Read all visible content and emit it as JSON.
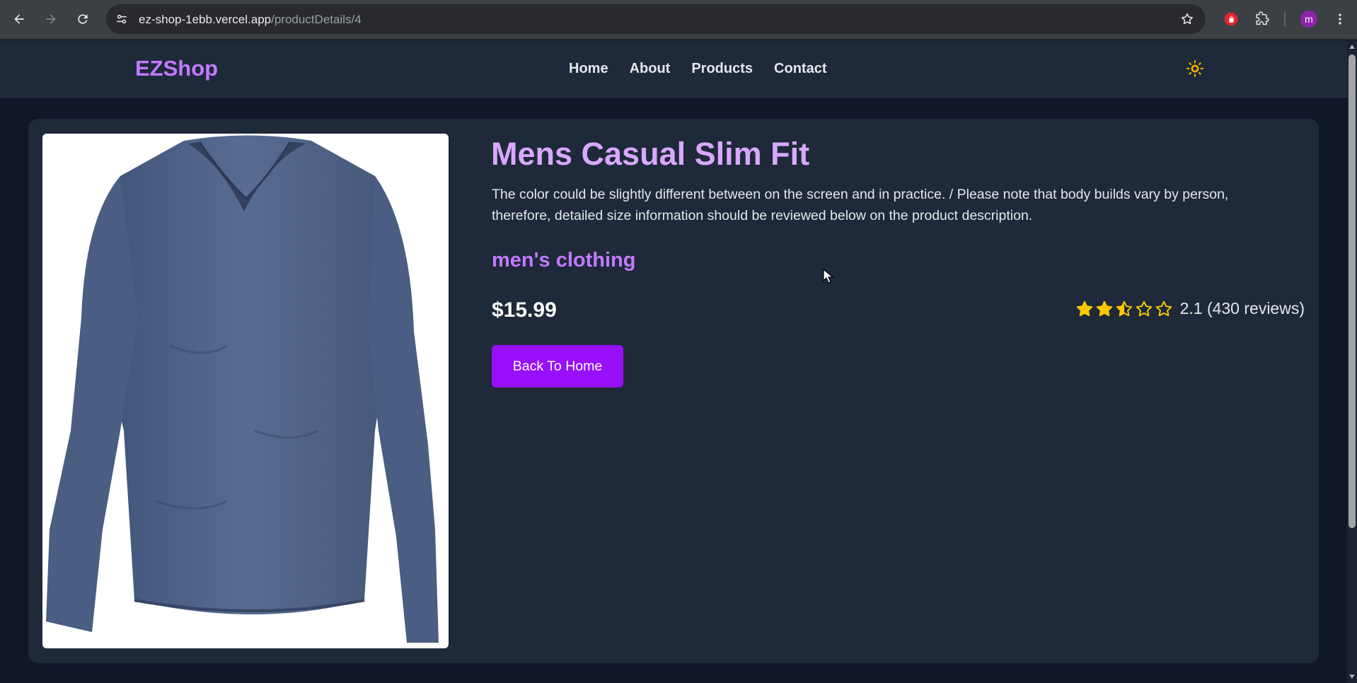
{
  "browser": {
    "url_host": "ez-shop-1ebb.vercel.app",
    "url_path": "/productDetails/4",
    "avatar_initial": "m",
    "icons": [
      "back-arrow-icon",
      "forward-arrow-icon",
      "reload-icon",
      "site-settings-icon",
      "bookmark-star-icon",
      "extension-stop-icon",
      "extensions-puzzle-icon",
      "profile-avatar",
      "kebab-menu-icon"
    ]
  },
  "header": {
    "logo": "EZShop",
    "nav": [
      "Home",
      "About",
      "Products",
      "Contact"
    ],
    "theme_icon": "sun-icon"
  },
  "product": {
    "title": "Mens Casual Slim Fit",
    "description": "The color could be slightly different between on the screen and in practice. / Please note that body builds vary by person, therefore, detailed size information should be reviewed below on the product description.",
    "category": "men's clothing",
    "price": "$15.99",
    "rating_text": "2.1 (430 reviews)",
    "rating_value": 2.1,
    "rating_max": 5,
    "back_button": "Back To Home",
    "image_icon": "long-sleeve-shirt-image"
  },
  "colors": {
    "accent": "#c27aff",
    "title": "#d9a8ff",
    "button": "#9810fa",
    "star": "#fdc700",
    "card": "#1e2939",
    "page": "#0f1729"
  }
}
